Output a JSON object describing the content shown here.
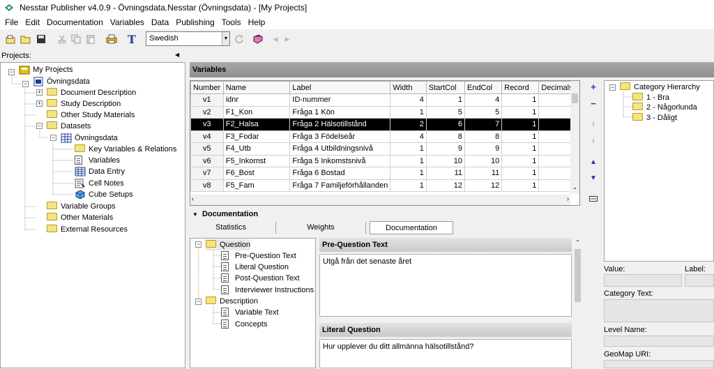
{
  "window": {
    "title": "Nesstar Publisher v4.0.9 - Övningsdata.Nesstar (Övningsdata) - [My Projects]"
  },
  "menu": [
    "File",
    "Edit",
    "Documentation",
    "Variables",
    "Data",
    "Publishing",
    "Tools",
    "Help"
  ],
  "toolbar": {
    "language": "Swedish"
  },
  "projects": {
    "label": "Projects:",
    "tree": {
      "root": "My Projects",
      "study": "Övningsdata",
      "doc_desc": "Document Description",
      "study_desc": "Study Description",
      "other_study": "Other Study Materials",
      "datasets": "Datasets",
      "dataset": "Övningsdata",
      "key_vars": "Key Variables & Relations",
      "variables": "Variables",
      "data_entry": "Data Entry",
      "cell_notes": "Cell Notes",
      "cube_setups": "Cube Setups",
      "var_groups": "Variable Groups",
      "other_materials": "Other Materials",
      "external": "External Resources"
    }
  },
  "variables": {
    "title": "Variables",
    "columns": [
      "Number",
      "Name",
      "Label",
      "Width",
      "StartCol",
      "EndCol",
      "Record",
      "Decimals"
    ],
    "rows": [
      [
        "v1",
        "idnr",
        "ID-nummer",
        "4",
        "1",
        "4",
        "1",
        ""
      ],
      [
        "v2",
        "F1_Kon",
        "Fråga 1 Kön",
        "1",
        "5",
        "5",
        "1",
        ""
      ],
      [
        "v3",
        "F2_Halsa",
        "Fråga 2 Hälsotillstånd",
        "2",
        "6",
        "7",
        "1",
        ""
      ],
      [
        "v4",
        "F3_Fodar",
        "Fråga 3 Födelseår",
        "4",
        "8",
        "8",
        "1",
        ""
      ],
      [
        "v5",
        "F4_Utb",
        "Fråga 4 Utbildningsnivå",
        "1",
        "9",
        "9",
        "1",
        ""
      ],
      [
        "v6",
        "F5_Inkomst",
        "Fråga 5 Inkomstsnivå",
        "1",
        "10",
        "10",
        "1",
        ""
      ],
      [
        "v7",
        "F6_Bost",
        "Fråga 6 Bostad",
        "1",
        "11",
        "11",
        "1",
        ""
      ],
      [
        "v8",
        "F5_Fam",
        "Fråga 7 Familjeförhållanden",
        "1",
        "12",
        "12",
        "1",
        ""
      ]
    ],
    "selected_row": 2
  },
  "category": {
    "root": "Category Hierarchy",
    "items": [
      "1 - Bra",
      "2 - Någorlunda",
      "3 - Dåligt"
    ],
    "value_label": "Value:",
    "label_label": "Label:",
    "cat_text_label": "Category Text:",
    "level_name_label": "Level Name:",
    "geomap_label": "GeoMap URI:"
  },
  "documentation": {
    "header": "Documentation",
    "tabs": [
      "Statistics",
      "Weights",
      "Documentation"
    ],
    "active_tab": 2,
    "tree": {
      "question": "Question",
      "pre_q": "Pre-Question Text",
      "literal_q": "Literal Question",
      "post_q": "Post-Question Text",
      "interviewer": "Interviewer Instructions",
      "description": "Description",
      "var_text": "Variable Text",
      "concepts": "Concepts"
    },
    "sections": [
      {
        "title": "Pre-Question Text",
        "text": "Utgå från det senaste året"
      },
      {
        "title": "Literal Question",
        "text": "Hur upplever du ditt allmänna hälsotillstånd?"
      }
    ]
  }
}
